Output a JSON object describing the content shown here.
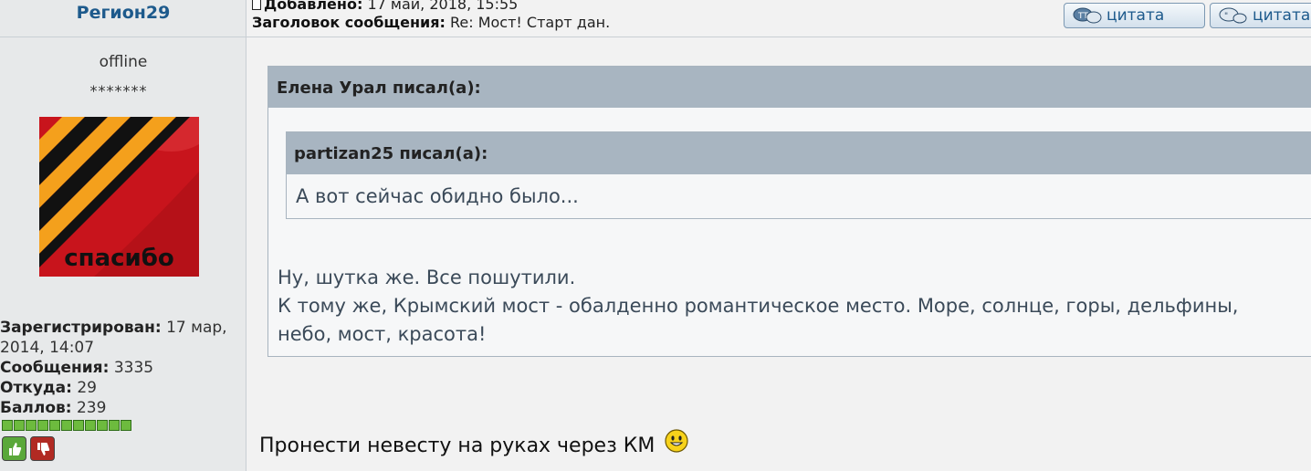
{
  "user": {
    "name": "Регион29",
    "status": "offline",
    "rank": "*******",
    "avatar_caption": "спасибо",
    "registered_label": "Зарегистрирован:",
    "registered_value": "17 мар, 2014, 14:07",
    "posts_label": "Сообщения:",
    "posts_value": "3335",
    "from_label": "Откуда:",
    "from_value": "29",
    "points_label": "Баллов:",
    "points_value": "239",
    "reputation_pips": 11
  },
  "post": {
    "added_label": "Добавлено:",
    "added_value": "17 май, 2018, 15:55",
    "subject_label": "Заголовок сообщения:",
    "subject_value": "Re: Мост! Старт дан.",
    "quote_button_label": "цитата",
    "quote_button_label_2": "цитата",
    "outer_quote_author": "Елена Урал писал(а):",
    "inner_quote_author": "partizan25 писал(а):",
    "inner_quote_text": "А вот сейчас обидно было...",
    "outer_quote_line1": "Ну, шутка же. Все пошутили.",
    "outer_quote_line2": "К тому же, Крымский мост - обалденно романтическое место. Море, солнце, горы, дельфины,",
    "outer_quote_line3": "небо, мост, красота!",
    "message": "Пронести невесту на руках через КМ"
  },
  "colors": {
    "username": "#1d5a8c",
    "quote_header": "#a8b5c1",
    "quote_text": "#3b4a59",
    "pip": "#6dbb3e"
  }
}
